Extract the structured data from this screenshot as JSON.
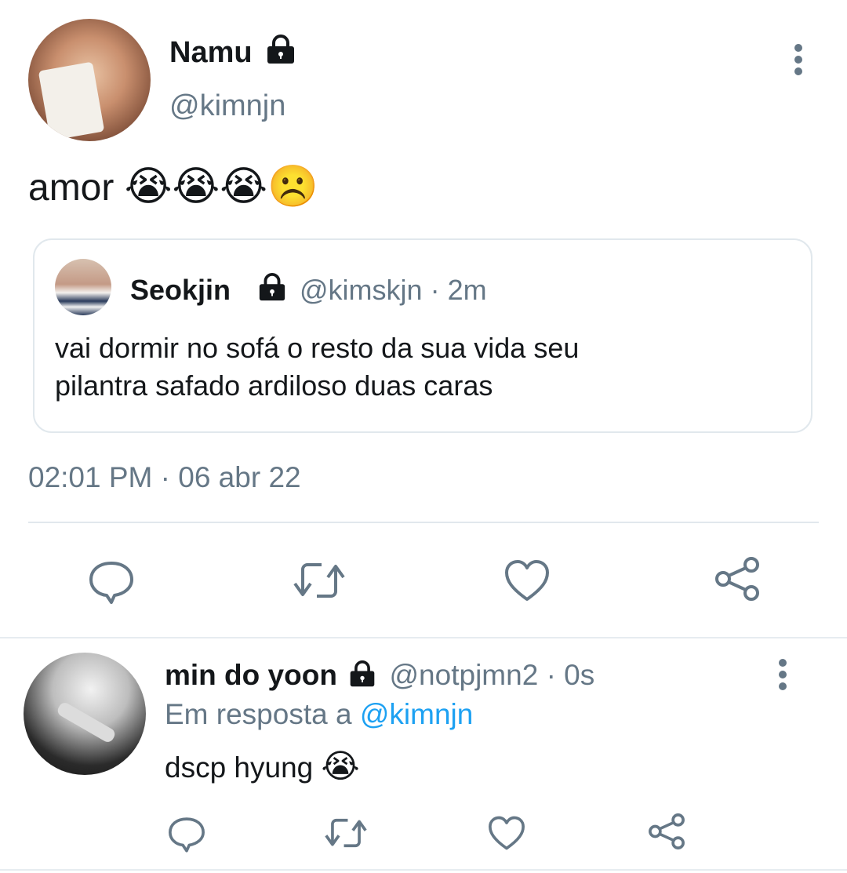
{
  "main_tweet": {
    "author_name": "Namu",
    "author_handle": "@kimnjn",
    "text": "amor",
    "emoji": "😭😭😭☹️",
    "timestamp": "02:01 PM · 06 abr 22",
    "icons": {
      "protected": "lock-icon",
      "more": "more-vertical-icon"
    }
  },
  "quoted_tweet": {
    "author_name": "Seokjin",
    "author_handle": "@kimskjn",
    "meta": "· 2m",
    "text_line1": "vai dormir no sofá o resto da sua vida seu",
    "text_line2": "pilantra safado ardiloso duas caras"
  },
  "actions": {
    "icons": [
      "reply-icon",
      "retweet-icon",
      "like-icon",
      "share-icon"
    ]
  },
  "reply_tweet": {
    "author_name": "min do yoon",
    "author_handle": "@notpjmn2",
    "meta": "· 0s",
    "reply_prefix": "Em resposta a",
    "reply_to": "@kimnjn",
    "text": "dscp hyung",
    "emoji": "😭"
  },
  "colors": {
    "text": "#14171a",
    "muted": "#657786",
    "link": "#1da1f2",
    "border": "#e1e8ed"
  }
}
